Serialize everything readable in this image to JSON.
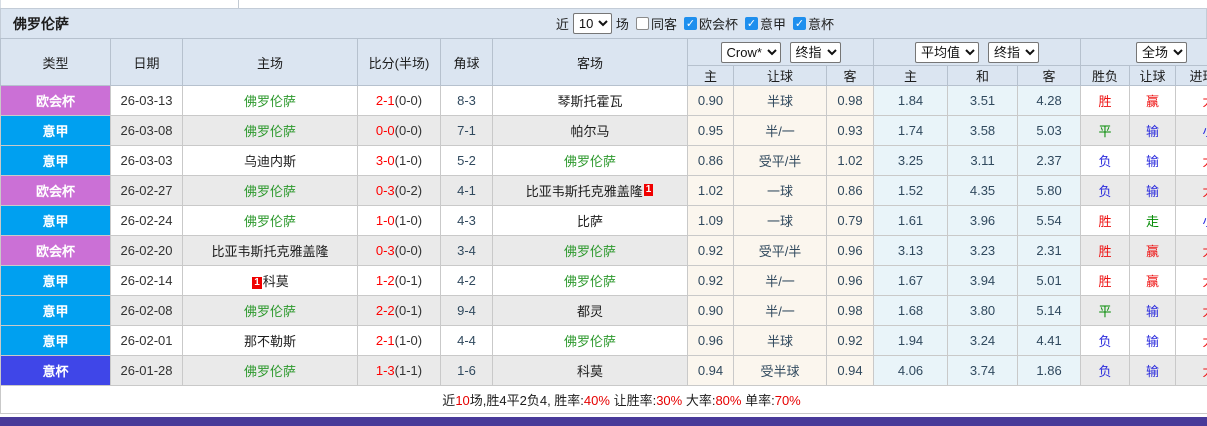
{
  "title_bar": {
    "team": "佛罗伦萨",
    "recent_label": "近",
    "recent_value": "10",
    "games_label": "场",
    "checkboxes": [
      {
        "key": "same-away-checkbox",
        "label": "同客",
        "checked": false
      },
      {
        "key": "europa-conference-checkbox",
        "label": "欧会杯",
        "checked": true
      },
      {
        "key": "serie-a-checkbox",
        "label": "意甲",
        "checked": true
      },
      {
        "key": "coppa-italia-checkbox",
        "label": "意杯",
        "checked": true
      }
    ]
  },
  "table": {
    "columns": {
      "type": "类型",
      "date": "日期",
      "home": "主场",
      "score": "比分(半场)",
      "corners": "角球",
      "away": "客场",
      "sub": [
        "主",
        "让球",
        "客",
        "主",
        "和",
        "客",
        "胜负",
        "让球",
        "进球数"
      ]
    },
    "selects": {
      "asia_source": "Crow*",
      "asia_stage": "终指",
      "europe_source": "平均值",
      "europe_stage": "终指",
      "scope": "全场"
    },
    "rows": [
      {
        "league": "欧会杯",
        "league_key": "europa",
        "date": "26-03-13",
        "home": {
          "name": "佛罗伦萨",
          "green": true
        },
        "score": "2-1",
        "half": "(0-0)",
        "corners": "8-3",
        "away": {
          "name": "琴斯托霍瓦",
          "green": false
        },
        "asia": [
          "0.90",
          "半球",
          "0.98"
        ],
        "europe": [
          "1.84",
          "3.51",
          "4.28"
        ],
        "result": {
          "text": "胜",
          "color": "red"
        },
        "handicap": {
          "text": "赢",
          "color": "red"
        },
        "goals": {
          "text": "大",
          "color": "red"
        }
      },
      {
        "league": "意甲",
        "league_key": "seriea",
        "date": "26-03-08",
        "home": {
          "name": "佛罗伦萨",
          "green": true
        },
        "score": "0-0",
        "half": "(0-0)",
        "corners": "7-1",
        "away": {
          "name": "帕尔马",
          "green": false
        },
        "asia": [
          "0.95",
          "半/一",
          "0.93"
        ],
        "europe": [
          "1.74",
          "3.58",
          "5.03"
        ],
        "result": {
          "text": "平",
          "color": "green"
        },
        "handicap": {
          "text": "输",
          "color": "blue"
        },
        "goals": {
          "text": "小",
          "color": "blue"
        }
      },
      {
        "league": "意甲",
        "league_key": "seriea",
        "date": "26-03-03",
        "home": {
          "name": "乌迪内斯",
          "green": false
        },
        "score": "3-0",
        "half": "(1-0)",
        "corners": "5-2",
        "away": {
          "name": "佛罗伦萨",
          "green": true
        },
        "asia": [
          "0.86",
          "受平/半",
          "1.02"
        ],
        "europe": [
          "3.25",
          "3.11",
          "2.37"
        ],
        "result": {
          "text": "负",
          "color": "blue"
        },
        "handicap": {
          "text": "输",
          "color": "blue"
        },
        "goals": {
          "text": "大",
          "color": "red"
        }
      },
      {
        "league": "欧会杯",
        "league_key": "europa",
        "date": "26-02-27",
        "home": {
          "name": "佛罗伦萨",
          "green": true
        },
        "score": "0-3",
        "half": "(0-2)",
        "corners": "4-1",
        "away": {
          "name": "比亚韦斯托克雅盖隆",
          "green": false,
          "card_post": "1"
        },
        "asia": [
          "1.02",
          "一球",
          "0.86"
        ],
        "europe": [
          "1.52",
          "4.35",
          "5.80"
        ],
        "result": {
          "text": "负",
          "color": "blue"
        },
        "handicap": {
          "text": "输",
          "color": "blue"
        },
        "goals": {
          "text": "大",
          "color": "red"
        }
      },
      {
        "league": "意甲",
        "league_key": "seriea",
        "date": "26-02-24",
        "home": {
          "name": "佛罗伦萨",
          "green": true
        },
        "score": "1-0",
        "half": "(1-0)",
        "corners": "4-3",
        "away": {
          "name": "比萨",
          "green": false
        },
        "asia": [
          "1.09",
          "一球",
          "0.79"
        ],
        "europe": [
          "1.61",
          "3.96",
          "5.54"
        ],
        "result": {
          "text": "胜",
          "color": "red"
        },
        "handicap": {
          "text": "走",
          "color": "green"
        },
        "goals": {
          "text": "小",
          "color": "blue"
        }
      },
      {
        "league": "欧会杯",
        "league_key": "europa",
        "date": "26-02-20",
        "home": {
          "name": "比亚韦斯托克雅盖隆",
          "green": false
        },
        "score": "0-3",
        "half": "(0-0)",
        "corners": "3-4",
        "away": {
          "name": "佛罗伦萨",
          "green": true
        },
        "asia": [
          "0.92",
          "受平/半",
          "0.96"
        ],
        "europe": [
          "3.13",
          "3.23",
          "2.31"
        ],
        "result": {
          "text": "胜",
          "color": "red"
        },
        "handicap": {
          "text": "赢",
          "color": "red"
        },
        "goals": {
          "text": "大",
          "color": "red"
        }
      },
      {
        "league": "意甲",
        "league_key": "seriea",
        "date": "26-02-14",
        "home": {
          "name": "科莫",
          "green": false,
          "card_pre": "1"
        },
        "score": "1-2",
        "half": "(0-1)",
        "corners": "4-2",
        "away": {
          "name": "佛罗伦萨",
          "green": true
        },
        "asia": [
          "0.92",
          "半/一",
          "0.96"
        ],
        "europe": [
          "1.67",
          "3.94",
          "5.01"
        ],
        "result": {
          "text": "胜",
          "color": "red"
        },
        "handicap": {
          "text": "赢",
          "color": "red"
        },
        "goals": {
          "text": "大",
          "color": "red"
        }
      },
      {
        "league": "意甲",
        "league_key": "seriea",
        "date": "26-02-08",
        "home": {
          "name": "佛罗伦萨",
          "green": true
        },
        "score": "2-2",
        "half": "(0-1)",
        "corners": "9-4",
        "away": {
          "name": "都灵",
          "green": false
        },
        "asia": [
          "0.90",
          "半/一",
          "0.98"
        ],
        "europe": [
          "1.68",
          "3.80",
          "5.14"
        ],
        "result": {
          "text": "平",
          "color": "green"
        },
        "handicap": {
          "text": "输",
          "color": "blue"
        },
        "goals": {
          "text": "大",
          "color": "red"
        }
      },
      {
        "league": "意甲",
        "league_key": "seriea",
        "date": "26-02-01",
        "home": {
          "name": "那不勒斯",
          "green": false
        },
        "score": "2-1",
        "half": "(1-0)",
        "corners": "4-4",
        "away": {
          "name": "佛罗伦萨",
          "green": true
        },
        "asia": [
          "0.96",
          "半球",
          "0.92"
        ],
        "europe": [
          "1.94",
          "3.24",
          "4.41"
        ],
        "result": {
          "text": "负",
          "color": "blue"
        },
        "handicap": {
          "text": "输",
          "color": "blue"
        },
        "goals": {
          "text": "大",
          "color": "red"
        }
      },
      {
        "league": "意杯",
        "league_key": "coppa",
        "date": "26-01-28",
        "home": {
          "name": "佛罗伦萨",
          "green": true
        },
        "score": "1-3",
        "half": "(1-1)",
        "corners": "1-6",
        "away": {
          "name": "科莫",
          "green": false
        },
        "asia": [
          "0.94",
          "受半球",
          "0.94"
        ],
        "europe": [
          "4.06",
          "3.74",
          "1.86"
        ],
        "result": {
          "text": "负",
          "color": "blue"
        },
        "handicap": {
          "text": "输",
          "color": "blue"
        },
        "goals": {
          "text": "大",
          "color": "red"
        }
      }
    ]
  },
  "footer": {
    "segments": [
      {
        "text": "近",
        "red": false
      },
      {
        "text": "10",
        "red": true
      },
      {
        "text": "场,胜4平2负4, 胜率:",
        "red": false
      },
      {
        "text": "40%",
        "red": true
      },
      {
        "text": " 让胜率:",
        "red": false
      },
      {
        "text": "30%",
        "red": true
      },
      {
        "text": " 大率:",
        "red": false
      },
      {
        "text": "80%",
        "red": true
      },
      {
        "text": " 单率:",
        "red": false
      },
      {
        "text": "70%",
        "red": true
      }
    ]
  },
  "icons": {
    "check": "✓"
  },
  "colors": {
    "league": {
      "europa": "#cb70d6",
      "seriea": "#00a0f0",
      "coppa": "#3f46e8"
    },
    "outcome": {
      "red": "#ee1111",
      "green": "#028a02",
      "blue": "#2b2bdd"
    },
    "score_red": "#ff0000",
    "team_green": "#2f9a2f",
    "stat_red": "#e60000",
    "bottom_bar": "#483a99"
  }
}
